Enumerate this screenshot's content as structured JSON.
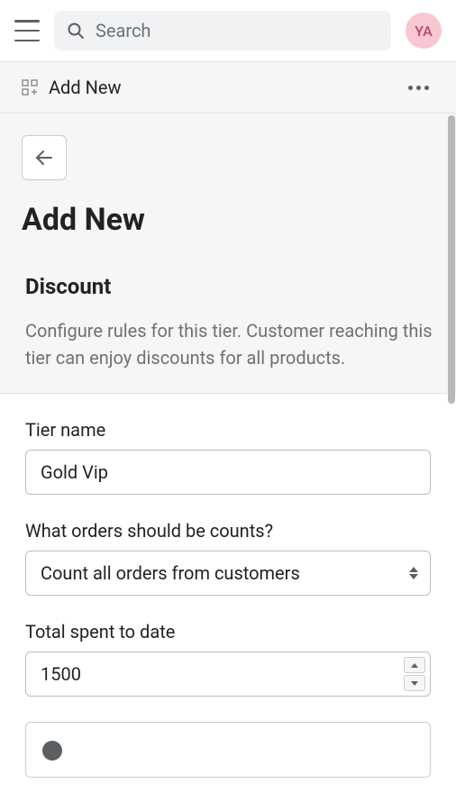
{
  "topbar": {
    "search_placeholder": "Search",
    "avatar_initials": "YA"
  },
  "subheader": {
    "title": "Add New"
  },
  "page": {
    "title": "Add New",
    "section_title": "Discount",
    "section_desc": "Configure rules for this tier. Customer reaching this tier can enjoy discounts for all products."
  },
  "form": {
    "tier_name_label": "Tier name",
    "tier_name_value": "Gold Vip",
    "orders_label": "What orders should be counts?",
    "orders_value": "Count all orders from customers",
    "total_spent_label": "Total spent to date",
    "total_spent_value": "1500"
  }
}
